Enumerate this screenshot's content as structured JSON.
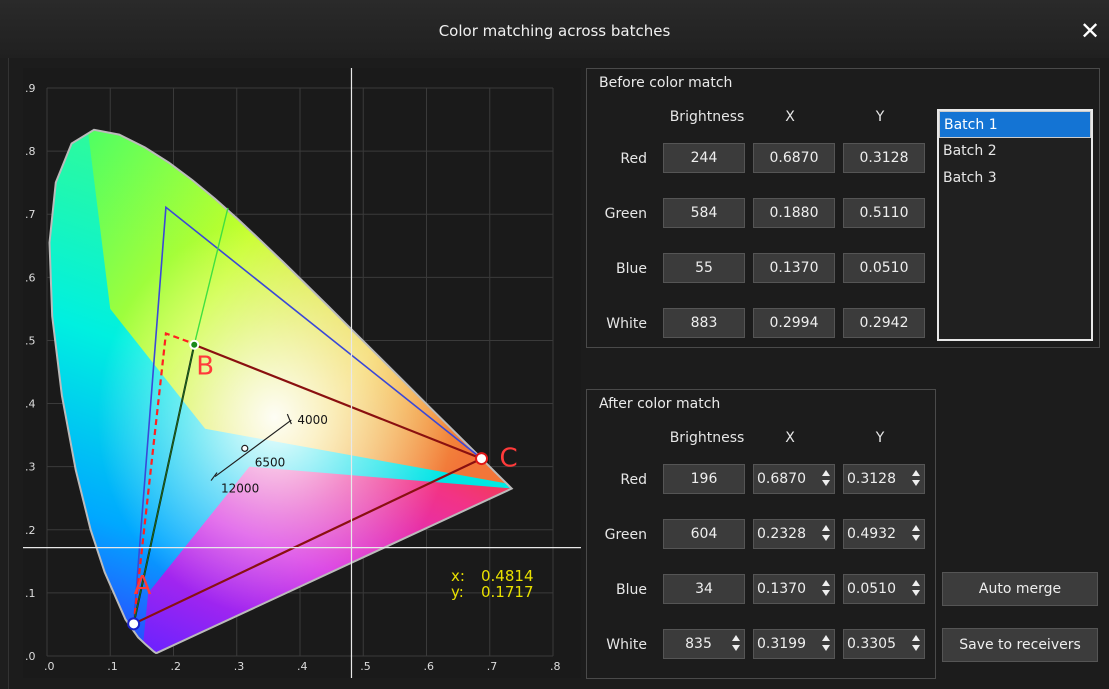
{
  "window": {
    "title": "Color matching across batches",
    "close_icon": "close-icon"
  },
  "chart": {
    "x_ticks": [
      ".0",
      ".1",
      ".2",
      ".3",
      ".4",
      ".5",
      ".6",
      ".7",
      ".8"
    ],
    "y_ticks": [
      ".0",
      ".1",
      ".2",
      ".3",
      ".4",
      ".5",
      ".6",
      ".7",
      ".8",
      ".9"
    ],
    "crosshair": {
      "x": 0.4814,
      "y": 0.1717
    },
    "readout": {
      "x_label": "x:",
      "x_value": "0.4814",
      "y_label": "y:",
      "y_value": "0.1717"
    },
    "points": {
      "A": "A",
      "B": "B",
      "C": "C"
    },
    "cct_labels": [
      "4000",
      "6500",
      "12000"
    ]
  },
  "chart_data": {
    "type": "scatter",
    "xlim": [
      0,
      0.8
    ],
    "ylim": [
      0,
      0.9
    ],
    "grid": true,
    "gamut_triangle": [
      [
        0.687,
        0.3128
      ],
      [
        0.188,
        0.711
      ],
      [
        0.137,
        0.051
      ]
    ],
    "matched_triangle": [
      [
        0.687,
        0.3128
      ],
      [
        0.2328,
        0.4932
      ],
      [
        0.137,
        0.051
      ]
    ],
    "points": [
      {
        "label": "A",
        "x": 0.137,
        "y": 0.051
      },
      {
        "label": "B",
        "x": 0.2328,
        "y": 0.4932
      },
      {
        "label": "C",
        "x": 0.687,
        "y": 0.3128
      }
    ],
    "cct_points": [
      {
        "label": "4000",
        "x": 0.38,
        "y": 0.377
      },
      {
        "label": "6500",
        "x": 0.3127,
        "y": 0.329
      },
      {
        "label": "12000",
        "x": 0.272,
        "y": 0.278
      }
    ],
    "cursor": {
      "x": 0.4814,
      "y": 0.1717
    }
  },
  "before": {
    "title": "Before color match",
    "headers": [
      "Brightness",
      "X",
      "Y"
    ],
    "rows": [
      {
        "label": "Red",
        "brightness": "244",
        "x": "0.6870",
        "y": "0.3128"
      },
      {
        "label": "Green",
        "brightness": "584",
        "x": "0.1880",
        "y": "0.5110"
      },
      {
        "label": "Blue",
        "brightness": "55",
        "x": "0.1370",
        "y": "0.0510"
      },
      {
        "label": "White",
        "brightness": "883",
        "x": "0.2994",
        "y": "0.2942"
      }
    ],
    "batches": [
      "Batch 1",
      "Batch 2",
      "Batch 3"
    ],
    "selected_batch": "Batch 1"
  },
  "after": {
    "title": "After color match",
    "headers": [
      "Brightness",
      "X",
      "Y"
    ],
    "rows": [
      {
        "label": "Red",
        "brightness": "196",
        "x": "0.6870",
        "y": "0.3128"
      },
      {
        "label": "Green",
        "brightness": "604",
        "x": "0.2328",
        "y": "0.4932"
      },
      {
        "label": "Blue",
        "brightness": "34",
        "x": "0.1370",
        "y": "0.0510"
      },
      {
        "label": "White",
        "brightness": "835",
        "x": "0.3199",
        "y": "0.3305"
      }
    ]
  },
  "buttons": {
    "auto_merge": "Auto merge",
    "save": "Save to receivers"
  },
  "colors": {
    "accent": "#1474d4",
    "readout": "#e8e000",
    "point_label": "#ff3a3a"
  }
}
